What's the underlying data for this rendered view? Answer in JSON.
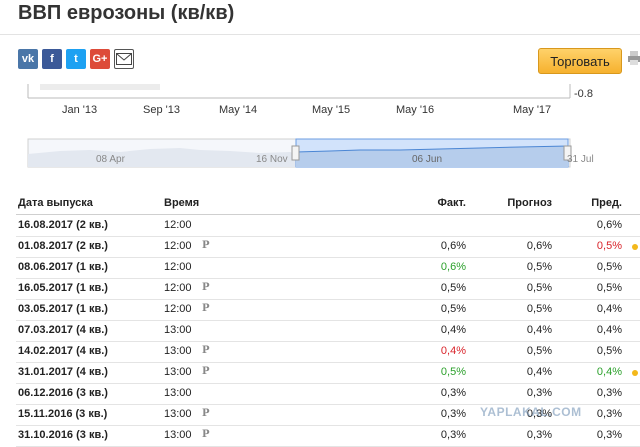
{
  "title": "ВВП еврозоны (кв/кв)",
  "social": [
    {
      "icon": "vk-icon",
      "label": "vk"
    },
    {
      "icon": "facebook-icon",
      "label": "f"
    },
    {
      "icon": "twitter-icon",
      "label": "t"
    },
    {
      "icon": "google-plus-icon",
      "label": "G+"
    },
    {
      "icon": "mail-icon",
      "label": "✉"
    }
  ],
  "trade_button": "Торговать",
  "chart": {
    "x_labels": [
      "Jan '13",
      "Sep '13",
      "May '14",
      "May '15",
      "May '16",
      "May '17"
    ],
    "y_label": "-0.8",
    "navigator_labels": [
      "08 Apr",
      "16 Nov",
      "06 Jun",
      "31 Jul"
    ]
  },
  "table": {
    "headers": {
      "date": "Дата выпуска",
      "time": "Время",
      "actual": "Факт.",
      "forecast": "Прогноз",
      "previous": "Пред."
    },
    "rows": [
      {
        "date": "16.08.2017 (2 кв.)",
        "time": "12:00",
        "prelim": "",
        "actual": "",
        "actual_color": "",
        "forecast": "",
        "previous": "0,6%",
        "previous_color": "",
        "dot": false
      },
      {
        "date": "01.08.2017 (2 кв.)",
        "time": "12:00",
        "prelim": "P",
        "actual": "0,6%",
        "actual_color": "",
        "forecast": "0,6%",
        "previous": "0,5%",
        "previous_color": "neg",
        "dot": true
      },
      {
        "date": "08.06.2017 (1 кв.)",
        "time": "12:00",
        "prelim": "",
        "actual": "0,6%",
        "actual_color": "pos",
        "forecast": "0,5%",
        "previous": "0,5%",
        "previous_color": "",
        "dot": false
      },
      {
        "date": "16.05.2017 (1 кв.)",
        "time": "12:00",
        "prelim": "P",
        "actual": "0,5%",
        "actual_color": "",
        "forecast": "0,5%",
        "previous": "0,5%",
        "previous_color": "",
        "dot": false
      },
      {
        "date": "03.05.2017 (1 кв.)",
        "time": "12:00",
        "prelim": "P",
        "actual": "0,5%",
        "actual_color": "",
        "forecast": "0,5%",
        "previous": "0,4%",
        "previous_color": "",
        "dot": false
      },
      {
        "date": "07.03.2017 (4 кв.)",
        "time": "13:00",
        "prelim": "",
        "actual": "0,4%",
        "actual_color": "",
        "forecast": "0,4%",
        "previous": "0,4%",
        "previous_color": "",
        "dot": false
      },
      {
        "date": "14.02.2017 (4 кв.)",
        "time": "13:00",
        "prelim": "P",
        "actual": "0,4%",
        "actual_color": "neg",
        "forecast": "0,5%",
        "previous": "0,5%",
        "previous_color": "",
        "dot": false
      },
      {
        "date": "31.01.2017 (4 кв.)",
        "time": "13:00",
        "prelim": "P",
        "actual": "0,5%",
        "actual_color": "pos",
        "forecast": "0,4%",
        "previous": "0,4%",
        "previous_color": "pos",
        "dot": true
      },
      {
        "date": "06.12.2016 (3 кв.)",
        "time": "13:00",
        "prelim": "",
        "actual": "0,3%",
        "actual_color": "",
        "forecast": "0,3%",
        "previous": "0,3%",
        "previous_color": "",
        "dot": false
      },
      {
        "date": "15.11.2016 (3 кв.)",
        "time": "13:00",
        "prelim": "P",
        "actual": "0,3%",
        "actual_color": "",
        "forecast": "0,3%",
        "previous": "0,3%",
        "previous_color": "",
        "dot": false
      },
      {
        "date": "31.10.2016 (3 кв.)",
        "time": "13:00",
        "prelim": "P",
        "actual": "0,3%",
        "actual_color": "",
        "forecast": "0,3%",
        "previous": "0,3%",
        "previous_color": "",
        "dot": false
      }
    ]
  },
  "watermark": "YAPLAKAL.COM"
}
